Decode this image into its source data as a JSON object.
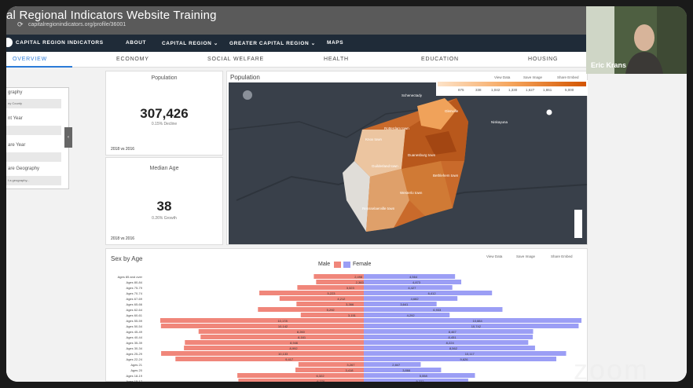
{
  "video": {
    "title": "al Regional Indicators Website Training",
    "url": "capitalregionindicators.org/profile/36001",
    "zoom_watermark": "zoom"
  },
  "nav": {
    "items": [
      "CAPITAL REGION INDICATORS",
      "ABOUT",
      "CAPITAL REGION ⌄",
      "GREATER CAPITAL REGION ⌄",
      "MAPS"
    ]
  },
  "tabs": [
    "OVERVIEW",
    "ECONOMY",
    "SOCIAL WELFARE",
    "HEALTH",
    "EDUCATION",
    "HOUSING"
  ],
  "filters": {
    "labels": [
      "graphy",
      "nt Year",
      "are Year",
      "are Geography"
    ],
    "box_values": [
      "ny County",
      "",
      "",
      "t a geography..."
    ]
  },
  "cards": {
    "population": {
      "title": "Population",
      "value": "307,426",
      "sub": "0.15% Decline",
      "foot": "2018 vs 2016"
    },
    "median_age": {
      "title": "Median Age",
      "value": "38",
      "sub": "0.26% Growth",
      "foot": "2018 vs 2016"
    }
  },
  "map": {
    "title": "Population",
    "links": [
      "View Data",
      "Save Image",
      "Share Embed"
    ],
    "legend_values": [
      "875",
      "338",
      "1,042",
      "1,330",
      "1,627",
      "1,861",
      "5,000"
    ],
    "places": [
      "Schenectady",
      "Rotterdam town",
      "Glenville",
      "Niskayuna",
      "Knox town",
      "Duanesburg town",
      "Guilderland town",
      "Bethlehem town",
      "Westerlo town",
      "Rensselaerville town"
    ]
  },
  "chart": {
    "title": "Sex by Age",
    "links": [
      "View Data",
      "Save Image",
      "Share Embed"
    ],
    "legend": {
      "male": "Male",
      "female": "Female"
    },
    "colors": {
      "male": "#f0867a",
      "female": "#9b9ef5"
    }
  },
  "chart_data": {
    "type": "bar",
    "title": "Sex by Age",
    "categories": [
      "Ages 85 and over",
      "Ages 80-84",
      "Ages 75-79",
      "Ages 70-74",
      "Ages 67-69",
      "Ages 65-66",
      "Ages 62-64",
      "Ages 60-61",
      "Ages 55-59",
      "Ages 50-54",
      "Ages 45-49",
      "Ages 40-44",
      "Ages 35-39",
      "Ages 30-34",
      "Ages 25-29",
      "Ages 22-24",
      "Ages 21",
      "Ages 20",
      "Ages 18-19",
      "Ages 15-17"
    ],
    "series": [
      {
        "name": "Male",
        "values": [
          2498,
          2383,
          3323,
          5223,
          4212,
          3366,
          5292,
          3151,
          10178,
          10142,
          8260,
          8161,
          8946,
          8992,
          10133,
          9417,
          3267,
          3418,
          6322,
          6270
        ]
      },
      {
        "name": "Female",
        "values": [
          4564,
          4873,
          4427,
          6412,
          4682,
          3641,
          6933,
          4292,
          10884,
          10742,
          8467,
          8451,
          8224,
          8562,
          10117,
          9626,
          2847,
          3866,
          5558,
          5222
        ]
      }
    ]
  },
  "webcam": {
    "name": "Eric Krans"
  }
}
